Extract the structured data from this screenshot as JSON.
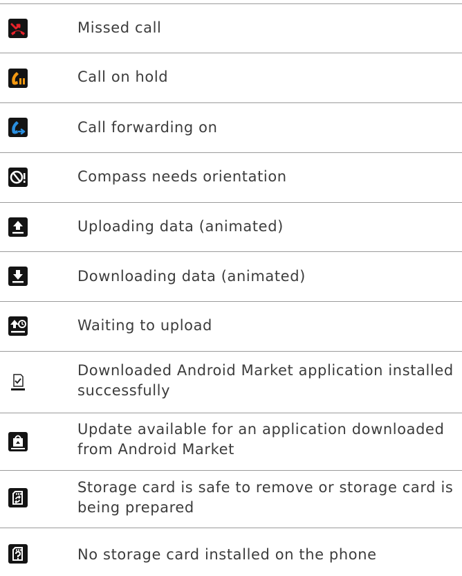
{
  "items": [
    {
      "icon": "missed-call-icon",
      "label": "Missed call"
    },
    {
      "icon": "call-on-hold-icon",
      "label": "Call on hold"
    },
    {
      "icon": "call-forwarding-icon",
      "label": "Call forwarding on"
    },
    {
      "icon": "compass-orientation-icon",
      "label": "Compass needs orientation"
    },
    {
      "icon": "uploading-data-icon",
      "label": "Uploading data (animated)"
    },
    {
      "icon": "downloading-data-icon",
      "label": "Downloading data (animated)"
    },
    {
      "icon": "waiting-to-upload-icon",
      "label": "Waiting to upload"
    },
    {
      "icon": "market-app-installed-icon",
      "label": "Downloaded Android Market application installed successfully"
    },
    {
      "icon": "market-update-available-icon",
      "label": "Update available for an application downloaded from Android Market"
    },
    {
      "icon": "storage-card-preparing-icon",
      "label": "Storage card is safe to remove or storage card is being prepared"
    },
    {
      "icon": "no-storage-card-icon",
      "label": "No storage card installed on the phone"
    }
  ],
  "colors": {
    "separator": "#9a9a9a",
    "text": "#3c3c3c",
    "missed_call_red": "#e8232b",
    "call_orange": "#f59a12",
    "call_blue": "#2a8fe0"
  }
}
